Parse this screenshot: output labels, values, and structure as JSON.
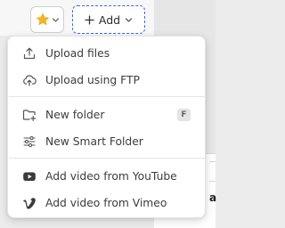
{
  "toolbar": {
    "favorites_icon": "star-icon",
    "favorites_color": "#f5b623",
    "add_label": "Add"
  },
  "menu": {
    "items": [
      {
        "label": "Upload files",
        "icon": "upload-icon"
      },
      {
        "label": "Upload using FTP",
        "icon": "cloud-upload-icon"
      },
      {
        "label": "New folder",
        "icon": "folder-plus-icon",
        "shortcut": "F"
      },
      {
        "label": "New Smart Folder",
        "icon": "sliders-icon"
      },
      {
        "label": "Add video from YouTube",
        "icon": "youtube-icon"
      },
      {
        "label": "Add video from Vimeo",
        "icon": "vimeo-icon"
      }
    ]
  },
  "background": {
    "partial_letter": "a"
  },
  "colors": {
    "accent": "#2f6fd6",
    "star": "#f5b623"
  }
}
